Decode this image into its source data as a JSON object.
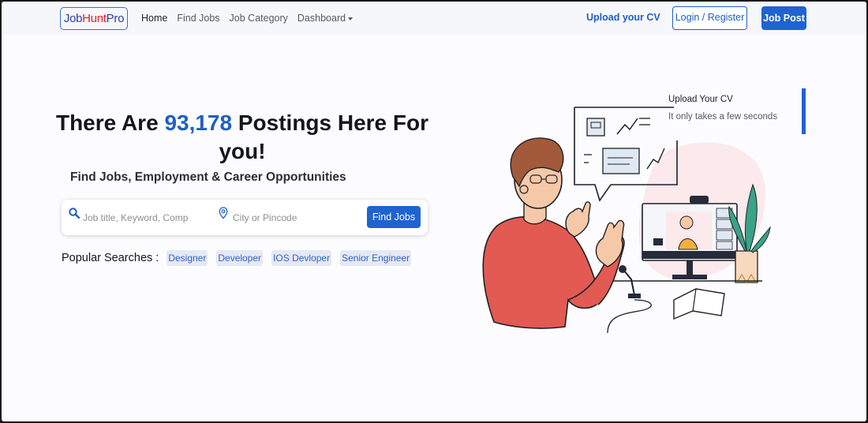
{
  "brand": {
    "logo_part1": "Job",
    "logo_part2": "Hunt",
    "logo_part3": "Pro",
    "primary_color": "#1f63d1",
    "logo_accent": "#d9242f"
  },
  "nav": {
    "links": [
      {
        "label": "Home"
      },
      {
        "label": "Find Jobs"
      },
      {
        "label": "Job Category"
      },
      {
        "label": "Dashboard"
      }
    ],
    "upload_cv": "Upload your CV",
    "login": "Login / Register",
    "job_post": "Job Post"
  },
  "hero": {
    "title_prefix": "There Are ",
    "count": "93,178",
    "title_suffix": " Postings Here For you!",
    "subtitle": "Find Jobs, Employment & Career Opportunities"
  },
  "search": {
    "keyword_placeholder": "Job title, Keyword, Company",
    "location_placeholder": "City or Pincode",
    "button": "Find Jobs"
  },
  "popular": {
    "label": "Popular Searches :",
    "tags": [
      "Designer",
      "Developer",
      "IOS Devloper",
      "Senior Engineer"
    ]
  },
  "upload_card": {
    "title": "Upload Your CV",
    "subtitle": "It only takes a few seconds"
  }
}
